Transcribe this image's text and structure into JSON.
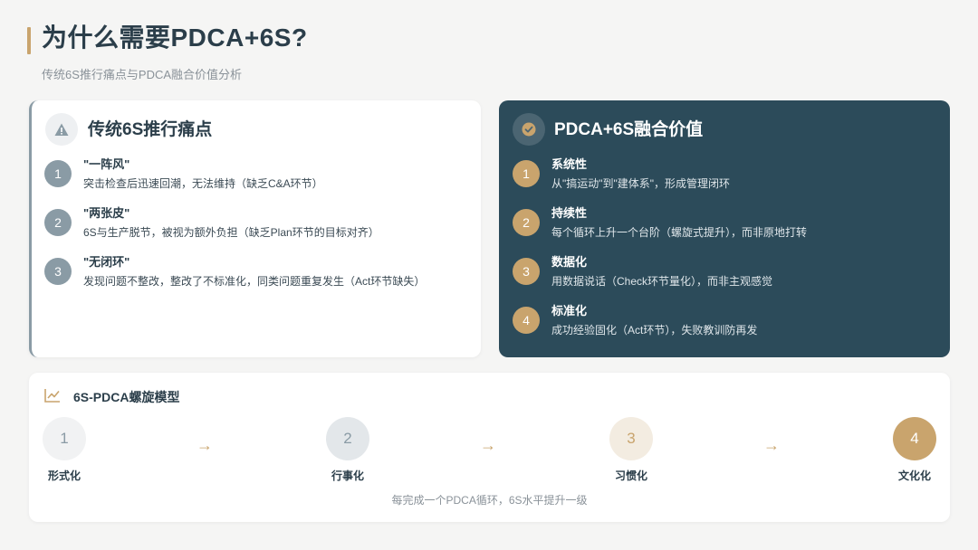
{
  "header": {
    "title": "为什么需要PDCA+6S?",
    "subtitle": "传统6S推行痛点与PDCA融合价值分析"
  },
  "left_card": {
    "icon": "warning-icon",
    "title": "传统6S推行痛点",
    "items": [
      {
        "num": "1",
        "title": "\"一阵风\"",
        "desc": "突击检查后迅速回潮，无法维持（缺乏C&A环节）"
      },
      {
        "num": "2",
        "title": "\"两张皮\"",
        "desc": "6S与生产脱节，被视为额外负担（缺乏Plan环节的目标对齐）"
      },
      {
        "num": "3",
        "title": "\"无闭环\"",
        "desc": "发现问题不整改，整改了不标准化，同类问题重复发生（Act环节缺失）"
      }
    ]
  },
  "right_card": {
    "icon": "check-circle-icon",
    "title": "PDCA+6S融合价值",
    "items": [
      {
        "num": "1",
        "title": "系统性",
        "desc": "从\"搞运动\"到\"建体系\"，形成管理闭环"
      },
      {
        "num": "2",
        "title": "持续性",
        "desc": "每个循环上升一个台阶（螺旋式提升），而非原地打转"
      },
      {
        "num": "3",
        "title": "数据化",
        "desc": "用数据说话（Check环节量化），而非主观感觉"
      },
      {
        "num": "4",
        "title": "标准化",
        "desc": "成功经验固化（Act环节），失败教训防再发"
      }
    ]
  },
  "model": {
    "icon": "line-chart-icon",
    "title": "6S-PDCA螺旋模型",
    "stages": [
      {
        "num": "1",
        "label": "形式化"
      },
      {
        "num": "2",
        "label": "行事化"
      },
      {
        "num": "3",
        "label": "习惯化"
      },
      {
        "num": "4",
        "label": "文化化"
      }
    ],
    "arrow": "→",
    "footnote": "每完成一个PDCA循环，6S水平提升一级"
  },
  "colors": {
    "primary": "#2b3e4a",
    "accent": "#c9a46d",
    "dark_card": "#2c4b5a",
    "muted": "#8a9ba5"
  }
}
